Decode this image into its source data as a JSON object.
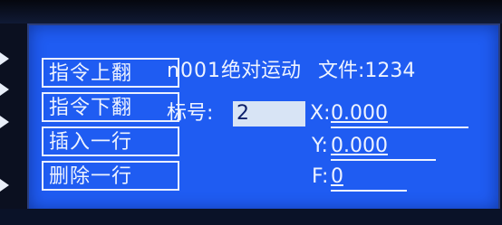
{
  "menu": {
    "items": [
      {
        "label": "指令上翻"
      },
      {
        "label": "指令下翻"
      },
      {
        "label": "插入一行"
      },
      {
        "label": "删除一行"
      }
    ]
  },
  "header": {
    "instruction_no": "n001",
    "instruction_name": "绝对运动",
    "file_label": "文件:",
    "file_no": "1234"
  },
  "fields": {
    "mark_label": "标号:",
    "mark_value": "2",
    "x_label": "X:",
    "x_value": "0.000",
    "y_label": "Y:",
    "y_value": "0.000",
    "f_label": "F:",
    "f_value": "0"
  },
  "colors": {
    "screen_background": "#1f5cf2",
    "text": "#eef3ff",
    "input_highlight": "#d8e4f5"
  }
}
